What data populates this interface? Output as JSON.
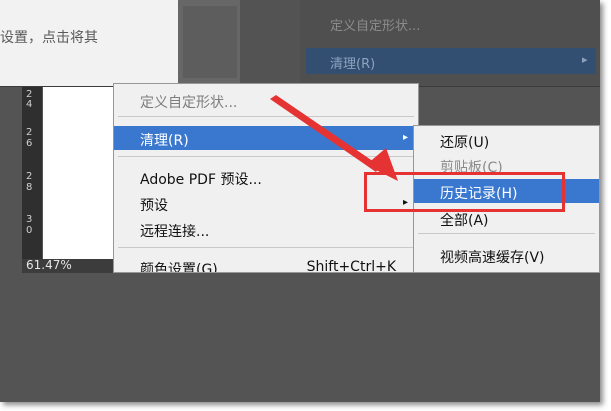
{
  "background": {
    "article_text": "设置，点击将其",
    "menu_item_faded": "定义自定形状...",
    "menu_item_highlighted": "清理(R)",
    "submenu_arrow": "▸"
  },
  "ruler": {
    "labels": [
      "2",
      "4",
      "2",
      "6",
      "2",
      "8",
      "3",
      "0"
    ]
  },
  "status": {
    "zoom": "61.47%"
  },
  "menu": {
    "define_shape": "定义自定形状...",
    "purge": "清理(R)",
    "purge_arrow": "▸",
    "pdf_presets": "Adobe PDF 预设...",
    "presets": "预设",
    "presets_arrow": "▸",
    "remote_connections": "远程连接...",
    "color_settings": "颜色设置(G)...",
    "color_settings_shortcut": "Shift+Ctrl+K"
  },
  "submenu": {
    "undo": "还原(U)",
    "clipboard": "剪贴板(C)",
    "histories": "历史记录(H)",
    "all": "全部(A)",
    "video_cache": "视频高速缓存(V)"
  },
  "colors": {
    "highlight": "#3a78d0",
    "annotation_red": "#e53232"
  },
  "icons": {
    "submenu_arrow": "triangle-right-icon"
  }
}
